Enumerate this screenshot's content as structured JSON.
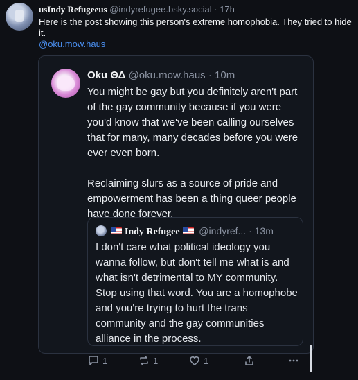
{
  "post": {
    "display_name": "usIndy Refugeeus",
    "handle": "@indyrefugee.bsky.social",
    "separator": "·",
    "time": "17h",
    "text": "Here is the post showing this person's extreme homophobia. They tried to hide it.",
    "mention": "@oku.mow.haus"
  },
  "quote": {
    "display_name": "Oku ΘΔ",
    "handle": "@oku.mow.haus",
    "separator": "·",
    "time": "10m",
    "paragraphs": [
      "You might be gay but you definitely aren't part of the gay community because if you were you'd know that we've been calling ourselves that for many, many decades before you were ever even born.",
      "Reclaiming slurs as a source of pride and empowerment has been a thing queer people have done forever."
    ],
    "inner": {
      "display_name": "Indy Refugee",
      "handle": "@indyref...",
      "separator": "·",
      "time": "13m",
      "text": "I don't care what political ideology you wanna follow, but don't tell me what is and what isn't detrimental to MY community. Stop using that word. You are a homophobe and you're trying to hurt the trans community and the gay communities alliance in the process."
    }
  },
  "actions": {
    "reply_count": "1",
    "repost_count": "1",
    "like_count": "1",
    "share_icon": "share-icon",
    "more_icon": "more-icon"
  },
  "colors": {
    "background": "#0e1015",
    "link": "#4a8ff0",
    "muted": "#8c94a3",
    "border": "#2b3240"
  }
}
